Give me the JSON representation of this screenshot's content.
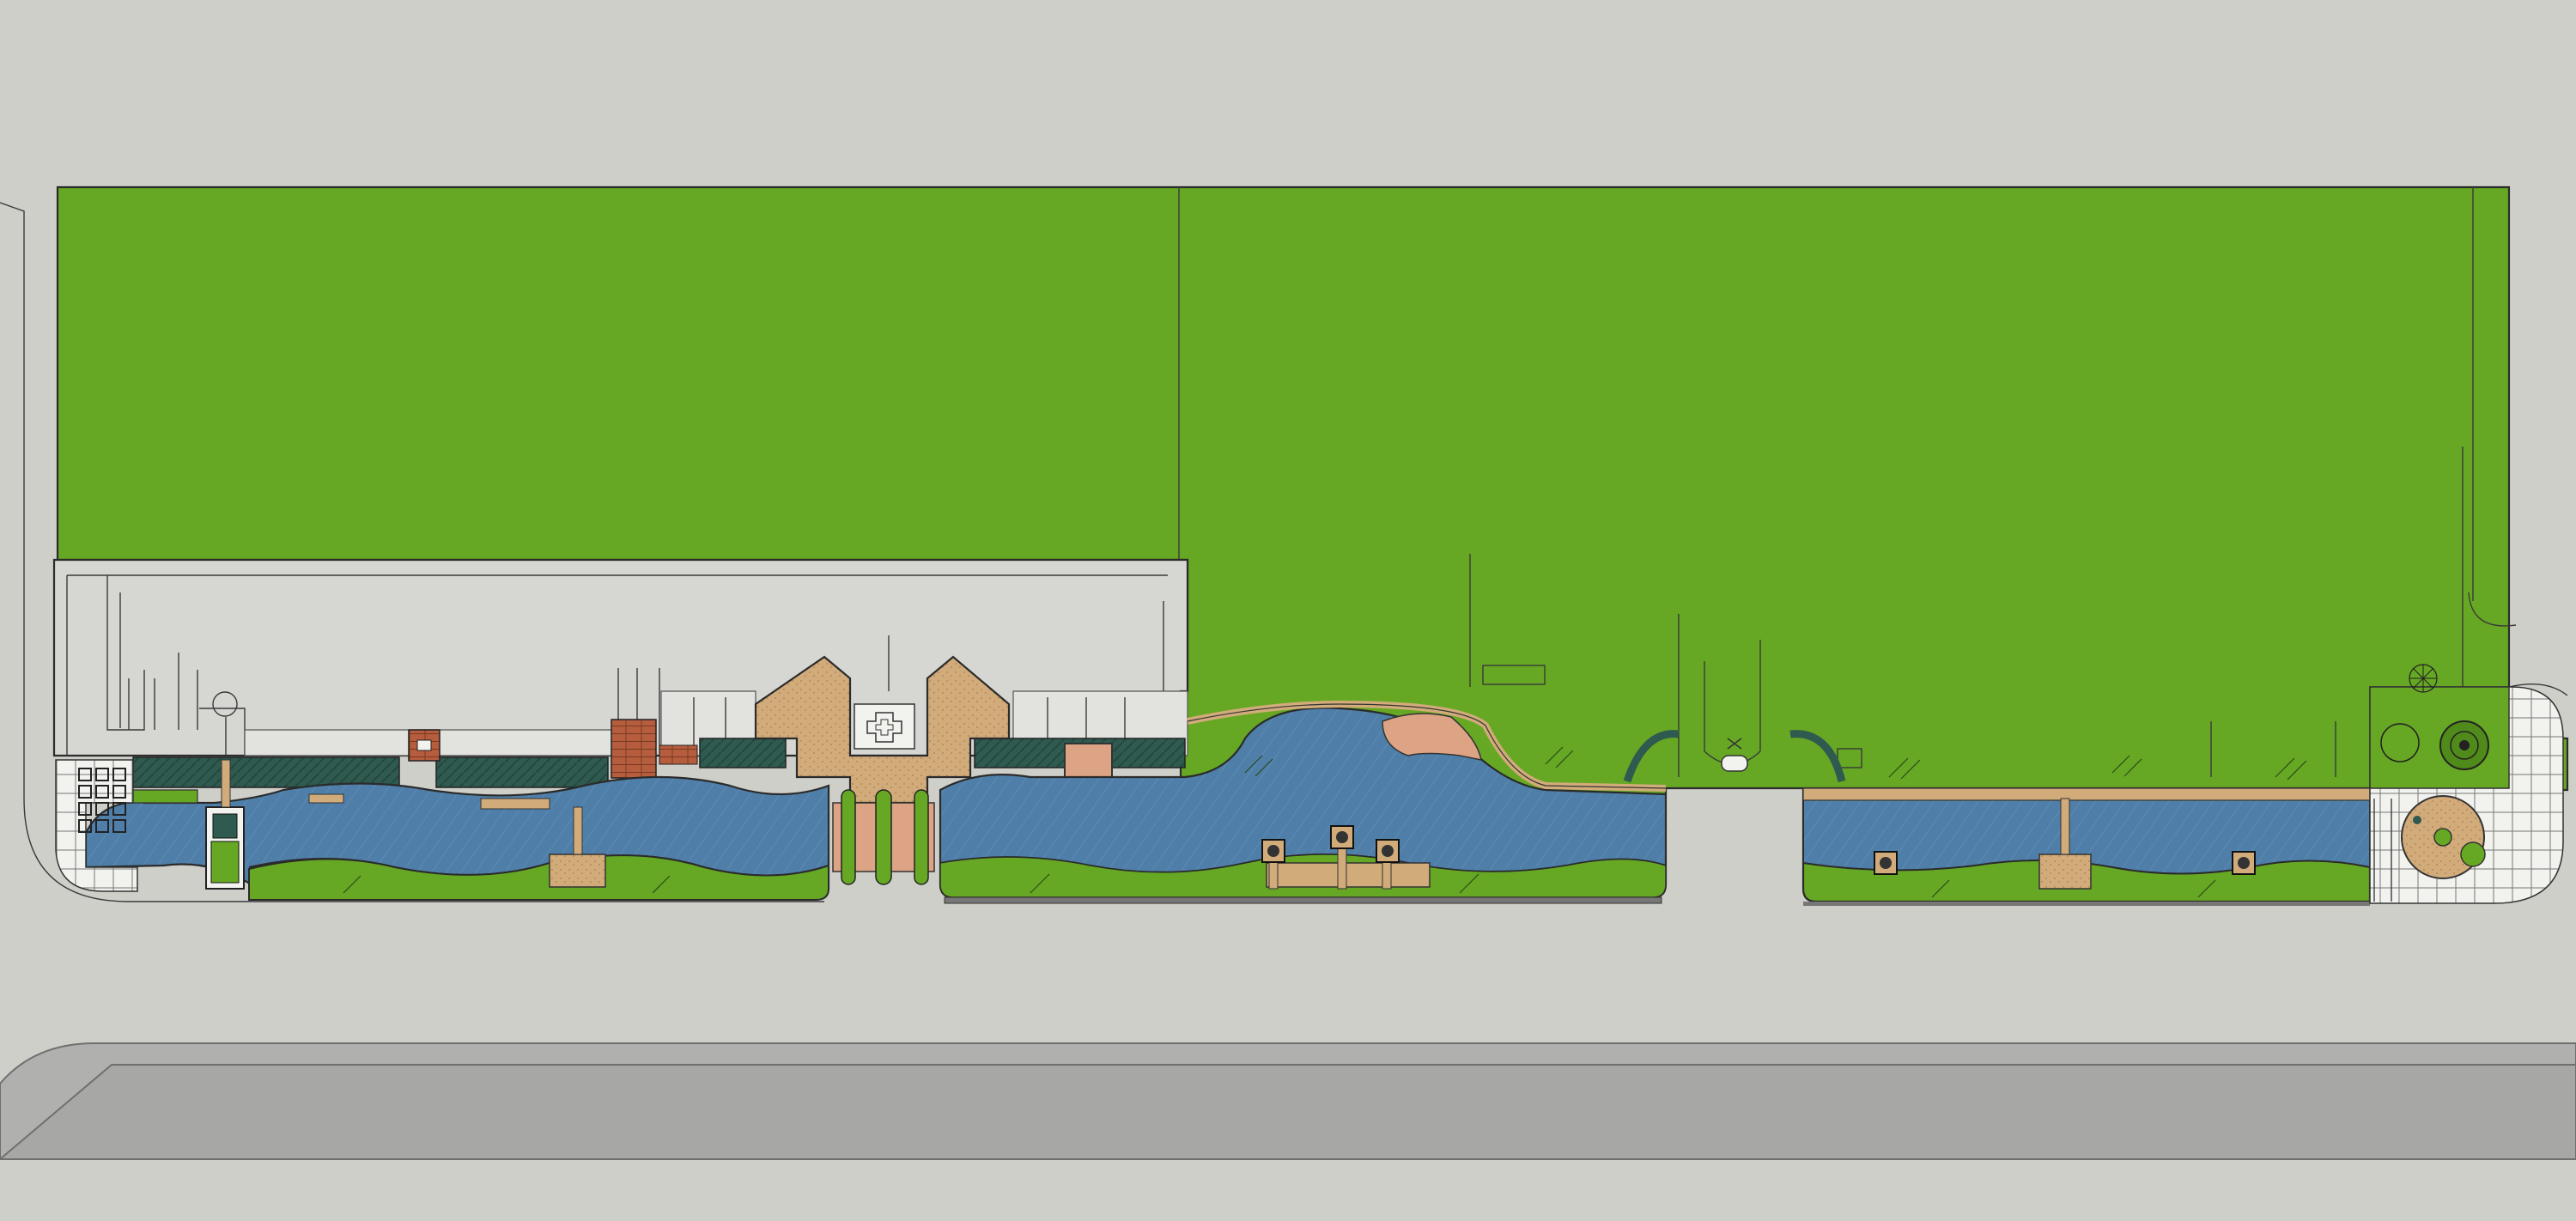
{
  "drawing": {
    "type": "landscape site plan",
    "colors": {
      "background": "#cfcfca",
      "lawn": "#66a823",
      "lawn_dark": "#4f8a1a",
      "water": "#4f7fa8",
      "paving_tan": "#d2ab7a",
      "paving_pink": "#dca385",
      "brick": "#b55d3d",
      "building_roof": "#d6d6d2",
      "hedge": "#2f5a4f",
      "road": "#a9a9a9",
      "tile_white": "#f2f2ee",
      "outline": "#2b2b2b"
    },
    "zones": [
      {
        "name": "north-lawn",
        "kind": "lawn"
      },
      {
        "name": "west-building",
        "kind": "building"
      },
      {
        "name": "central-plaza",
        "kind": "paving"
      },
      {
        "name": "west-canal",
        "kind": "water"
      },
      {
        "name": "central-pond",
        "kind": "water"
      },
      {
        "name": "east-canal",
        "kind": "water"
      },
      {
        "name": "south-road",
        "kind": "road"
      },
      {
        "name": "east-corner-plaza",
        "kind": "paving"
      }
    ],
    "icons": [
      "pavilion-icon",
      "circular-plaza-icon",
      "tree-icon",
      "gate-icon"
    ]
  }
}
